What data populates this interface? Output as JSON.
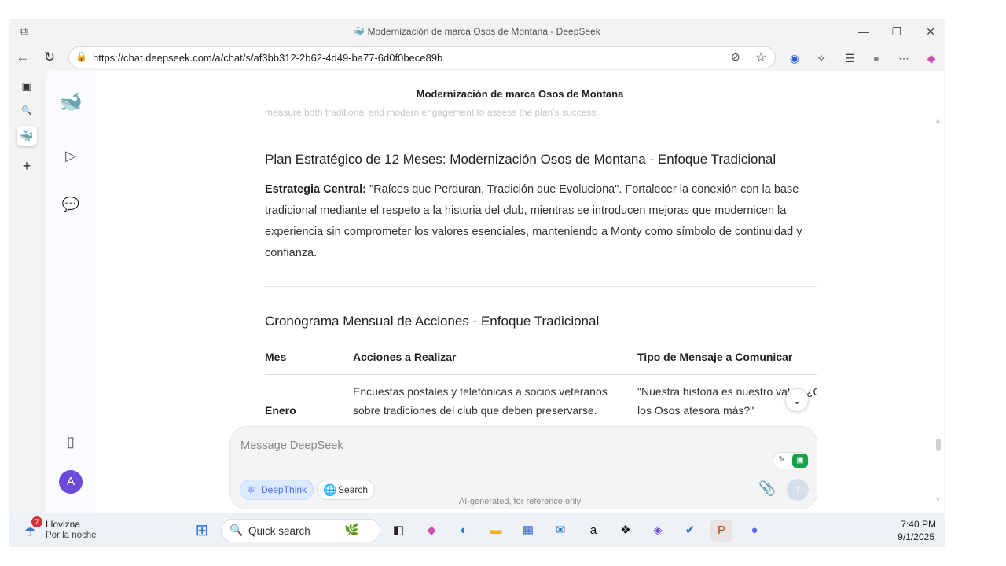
{
  "browser": {
    "tab_title": "Modernización de marca Osos de Montana - DeepSeek",
    "url": "https://chat.deepseek.com/a/chat/s/af3bb312-2b62-4d49-ba77-6d0f0bece89b"
  },
  "deepseek": {
    "chat_title": "Modernización de marca Osos de Montana",
    "avatar_letter": "A",
    "faded_line": "measure both traditional and modern engagement to assess the plan's success.",
    "plan_heading": "Plan Estratégico de 12 Meses: Modernización Osos de Montana - Enfoque Tradicional",
    "strategy_label": "Estrategia Central:",
    "strategy_text": " \"Raíces que Perduran, Tradición que Evoluciona\". Fortalecer la conexión con la base tradicional mediante el respeto a la historia del club, mientras se introducen mejoras que modernicen la experiencia sin comprometer los valores esenciales, manteniendo a Monty como símbolo de continuidad y confianza.",
    "schedule_heading": "Cronograma Mensual de Acciones - Enfoque Tradicional",
    "table": {
      "headers": [
        "Mes",
        "Acciones a Realizar",
        "Tipo de Mensaje a Comunicar"
      ],
      "rows": [
        {
          "month": "Enero",
          "action_line1": "Encuestas postales y telefónicas a socios veteranos",
          "action_line2": "sobre tradiciones del club que deben preservarse.",
          "message_line1": "\"Nuestra historia es nuestro val",
          "message_line1b": "¿Q",
          "message_line2": "los Osos atesora más?\""
        }
      ]
    },
    "composer": {
      "placeholder": "Message DeepSeek",
      "deepthink_label": "DeepThink",
      "search_label": "Search"
    },
    "footnote": "AI-generated, for reference only"
  },
  "taskbar": {
    "weather_title": "Llovizna",
    "weather_sub": "Por la noche",
    "weather_badge": "7",
    "search_label": "Quick search",
    "time": "7:40 PM",
    "date": "9/1/2025"
  },
  "colors": {
    "accent": "#4d6bfe",
    "deepthink_bg": "#dbeafe"
  }
}
